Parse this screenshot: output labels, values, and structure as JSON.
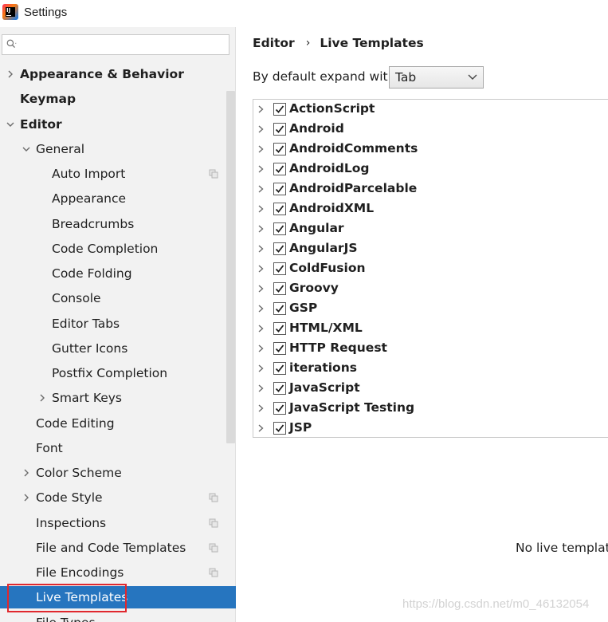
{
  "window": {
    "title": "Settings"
  },
  "search": {
    "placeholder": ""
  },
  "sidebar": {
    "items": [
      {
        "label": "Appearance & Behavior",
        "bold": true,
        "arrow": "right",
        "level": 0
      },
      {
        "label": "Keymap",
        "bold": true,
        "arrow": "none",
        "level": 0
      },
      {
        "label": "Editor",
        "bold": true,
        "arrow": "down",
        "level": 0
      },
      {
        "label": "General",
        "bold": false,
        "arrow": "down",
        "level": 1
      },
      {
        "label": "Auto Import",
        "bold": false,
        "arrow": "none",
        "level": 2,
        "copy_icon": true
      },
      {
        "label": "Appearance",
        "bold": false,
        "arrow": "none",
        "level": 2
      },
      {
        "label": "Breadcrumbs",
        "bold": false,
        "arrow": "none",
        "level": 2
      },
      {
        "label": "Code Completion",
        "bold": false,
        "arrow": "none",
        "level": 2
      },
      {
        "label": "Code Folding",
        "bold": false,
        "arrow": "none",
        "level": 2
      },
      {
        "label": "Console",
        "bold": false,
        "arrow": "none",
        "level": 2
      },
      {
        "label": "Editor Tabs",
        "bold": false,
        "arrow": "none",
        "level": 2
      },
      {
        "label": "Gutter Icons",
        "bold": false,
        "arrow": "none",
        "level": 2
      },
      {
        "label": "Postfix Completion",
        "bold": false,
        "arrow": "none",
        "level": 2
      },
      {
        "label": "Smart Keys",
        "bold": false,
        "arrow": "right",
        "level": 2
      },
      {
        "label": "Code Editing",
        "bold": false,
        "arrow": "none",
        "level": 1
      },
      {
        "label": "Font",
        "bold": false,
        "arrow": "none",
        "level": 1
      },
      {
        "label": "Color Scheme",
        "bold": false,
        "arrow": "right",
        "level": 1
      },
      {
        "label": "Code Style",
        "bold": false,
        "arrow": "right",
        "level": 1,
        "copy_icon": true
      },
      {
        "label": "Inspections",
        "bold": false,
        "arrow": "none",
        "level": 1,
        "copy_icon": true
      },
      {
        "label": "File and Code Templates",
        "bold": false,
        "arrow": "none",
        "level": 1,
        "copy_icon": true
      },
      {
        "label": "File Encodings",
        "bold": false,
        "arrow": "none",
        "level": 1,
        "copy_icon": true
      },
      {
        "label": "Live Templates",
        "bold": false,
        "arrow": "none",
        "level": 1,
        "selected": true
      },
      {
        "label": "File Types",
        "bold": false,
        "arrow": "none",
        "level": 1
      }
    ]
  },
  "breadcrumb": {
    "parent": "Editor",
    "separator": "›",
    "current": "Live Templates"
  },
  "expand": {
    "label": "By default expand with",
    "value": "Tab"
  },
  "templates": [
    {
      "label": "ActionScript",
      "checked": true
    },
    {
      "label": "Android",
      "checked": true
    },
    {
      "label": "AndroidComments",
      "checked": true
    },
    {
      "label": "AndroidLog",
      "checked": true
    },
    {
      "label": "AndroidParcelable",
      "checked": true
    },
    {
      "label": "AndroidXML",
      "checked": true
    },
    {
      "label": "Angular",
      "checked": true
    },
    {
      "label": "AngularJS",
      "checked": true
    },
    {
      "label": "ColdFusion",
      "checked": true
    },
    {
      "label": "Groovy",
      "checked": true
    },
    {
      "label": "GSP",
      "checked": true
    },
    {
      "label": "HTML/XML",
      "checked": true
    },
    {
      "label": "HTTP Request",
      "checked": true
    },
    {
      "label": "iterations",
      "checked": true
    },
    {
      "label": "JavaScript",
      "checked": true
    },
    {
      "label": "JavaScript Testing",
      "checked": true
    },
    {
      "label": "JSP",
      "checked": true
    }
  ],
  "details": {
    "empty_message": "No live template"
  },
  "watermark": "https://blog.csdn.net/m0_46132054",
  "colors": {
    "selection": "#2675bf",
    "highlight_border": "#e0282e",
    "sidebar_bg": "#f2f2f2"
  }
}
